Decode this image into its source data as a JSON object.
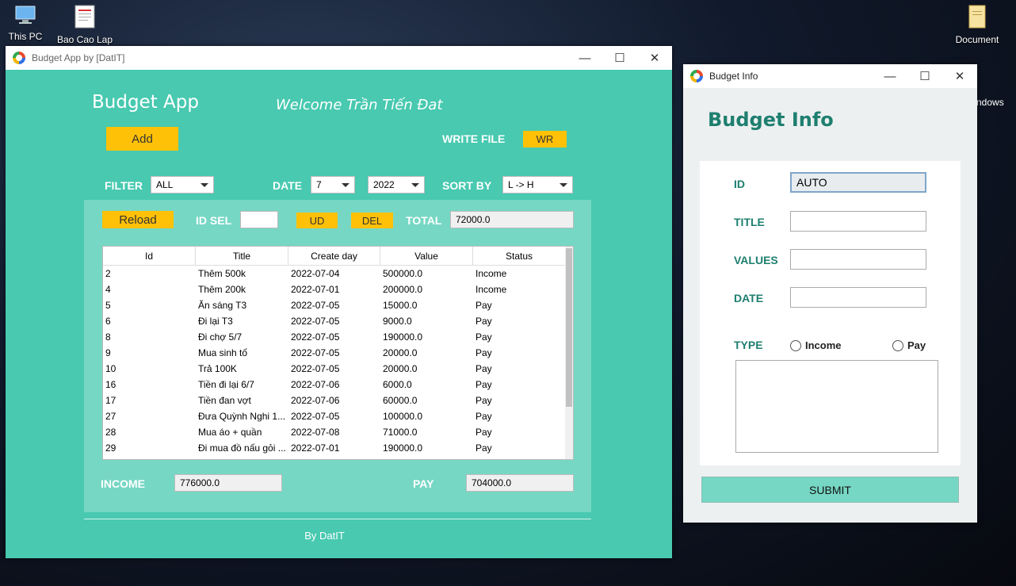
{
  "desktop": {
    "icons": [
      {
        "label": "This PC"
      },
      {
        "label": "Bao Cao Lap"
      },
      {
        "label": "Document"
      }
    ],
    "partial_label": "ndows"
  },
  "main_window": {
    "title": "Budget App by [DatIT]",
    "header": {
      "app_title": "Budget App",
      "welcome": "Welcome Trần Tiến Đat"
    },
    "add_label": "Add",
    "write_file_label": "WRITE FILE",
    "wr_label": "WR",
    "filter": {
      "label": "FILTER",
      "value": "ALL"
    },
    "date": {
      "label": "DATE",
      "month": "7",
      "year": "2022"
    },
    "sort": {
      "label": "SORT BY",
      "value": "L -> H"
    },
    "reload_label": "Reload",
    "id_sel_label": "ID SEL",
    "id_sel_value": "",
    "ud_label": "UD",
    "del_label": "DEL",
    "total_label": "TOTAL",
    "total_value": "72000.0",
    "table": {
      "columns": [
        "Id",
        "Title",
        "Create day",
        "Value",
        "Status"
      ],
      "rows": [
        [
          "2",
          "Thêm 500k",
          "2022-07-04",
          "500000.0",
          "Income"
        ],
        [
          "4",
          "Thêm 200k",
          "2022-07-01",
          "200000.0",
          "Income"
        ],
        [
          "5",
          "Ăn sáng T3",
          "2022-07-05",
          "15000.0",
          "Pay"
        ],
        [
          "6",
          "Đi lại T3",
          "2022-07-05",
          "9000.0",
          "Pay"
        ],
        [
          "8",
          "Đi chợ 5/7",
          "2022-07-05",
          "190000.0",
          "Pay"
        ],
        [
          "9",
          "Mua sinh tố",
          "2022-07-05",
          "20000.0",
          "Pay"
        ],
        [
          "10",
          "Trả 100K",
          "2022-07-05",
          "20000.0",
          "Pay"
        ],
        [
          "16",
          "Tiền đi lại 6/7",
          "2022-07-06",
          "6000.0",
          "Pay"
        ],
        [
          "17",
          "Tiền đan vợt",
          "2022-07-06",
          "60000.0",
          "Pay"
        ],
        [
          "27",
          "Đưa Quỳnh Nghi 1...",
          "2022-07-05",
          "100000.0",
          "Pay"
        ],
        [
          "28",
          "Mua áo + quần",
          "2022-07-08",
          "71000.0",
          "Pay"
        ],
        [
          "29",
          "Đi mua đồ nấu gỏi ...",
          "2022-07-01",
          "190000.0",
          "Pay"
        ]
      ]
    },
    "income_label": "INCOME",
    "income_value": "776000.0",
    "pay_label": "PAY",
    "pay_value": "704000.0",
    "footer": "By DatIT"
  },
  "info_window": {
    "title": "Budget Info",
    "heading": "Budget Info",
    "id_label": "ID",
    "id_value": "AUTO",
    "title_label": "TITLE",
    "title_value": "",
    "values_label": "VALUES",
    "values_value": "",
    "date_label": "DATE",
    "date_value": "",
    "type_label": "TYPE",
    "income_option": "Income",
    "pay_option": "Pay",
    "note_value": "",
    "submit_label": "SUBMIT"
  },
  "window_controls": {
    "minimize": "—",
    "maximize": "☐",
    "close": "✕"
  },
  "colors": {
    "teal": "#48c9b0",
    "teal_light": "#76d7c4",
    "yellow": "#ffc107",
    "info_green": "#1e7f6f"
  }
}
